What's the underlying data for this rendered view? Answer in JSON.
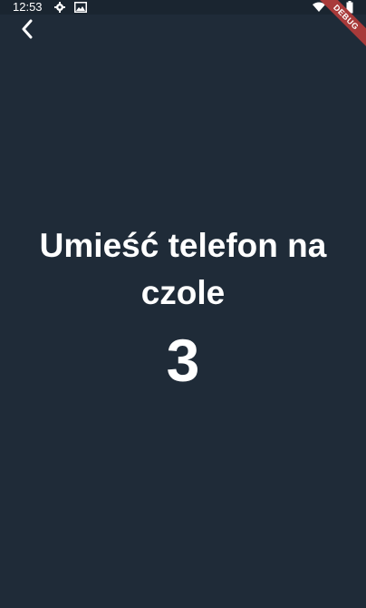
{
  "status_bar": {
    "time": "12:53",
    "icons": [
      "gear-icon",
      "image-icon",
      "wifi-icon",
      "battery-icon"
    ]
  },
  "debug_banner": {
    "label": "DEBUG",
    "color": "#a83a3a"
  },
  "header": {
    "back_icon": "chevron-left-icon"
  },
  "main": {
    "instruction": "Umieść telefon na czole",
    "countdown": "3"
  },
  "colors": {
    "background": "#1f2b38",
    "text": "#ffffff"
  }
}
